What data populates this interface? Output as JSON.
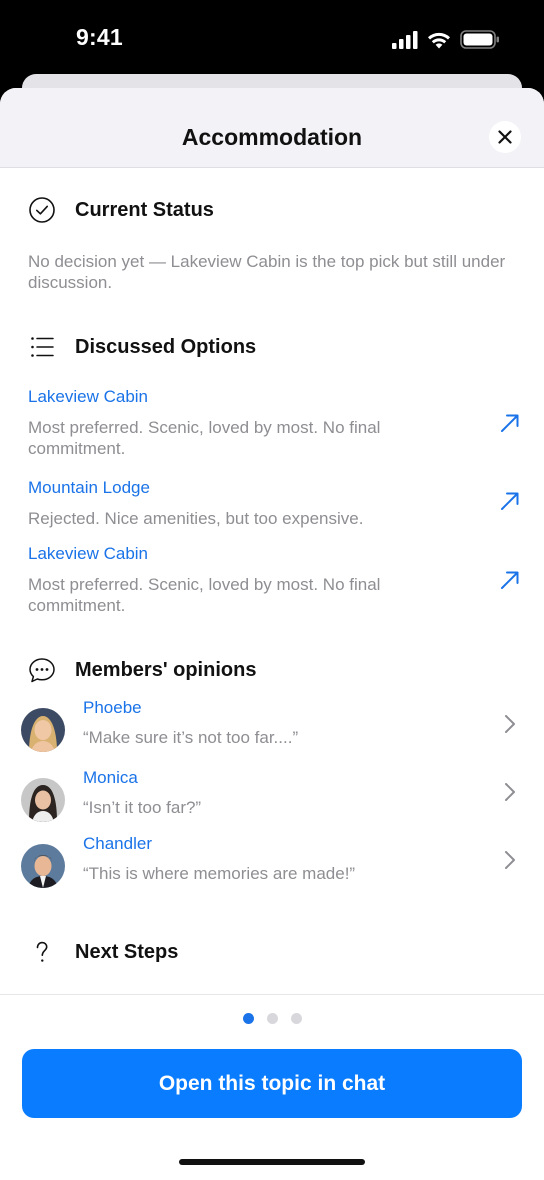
{
  "status_bar": {
    "time": "9:41"
  },
  "sheet": {
    "title": "Accommodation"
  },
  "current_status": {
    "title": "Current Status",
    "text": "No decision yet — Lakeview Cabin is the top pick but still under discussion."
  },
  "discussed_options": {
    "title": "Discussed Options",
    "items": [
      {
        "name": "Lakeview Cabin",
        "description": "Most preferred. Scenic, loved by most. No final commitment."
      },
      {
        "name": "Mountain Lodge",
        "description": "Rejected. Nice amenities, but too expensive."
      },
      {
        "name": "Lakeview Cabin",
        "description": "Most preferred. Scenic, loved by most. No final commitment."
      }
    ]
  },
  "members_opinions": {
    "title": "Members' opinions",
    "items": [
      {
        "name": "Phoebe",
        "quote": "“Make sure it’s not too far....”"
      },
      {
        "name": "Monica",
        "quote": "“Isn’t it too far?”"
      },
      {
        "name": "Chandler",
        "quote": "“This is where memories are made!”"
      }
    ]
  },
  "next_steps": {
    "title": "Next Steps"
  },
  "pagination": {
    "current": 1,
    "total": 3
  },
  "cta": {
    "label": "Open this topic in chat"
  },
  "colors": {
    "accent": "#1a73e8",
    "cta": "#0a7cff",
    "secondary_text": "#8e8e93"
  }
}
